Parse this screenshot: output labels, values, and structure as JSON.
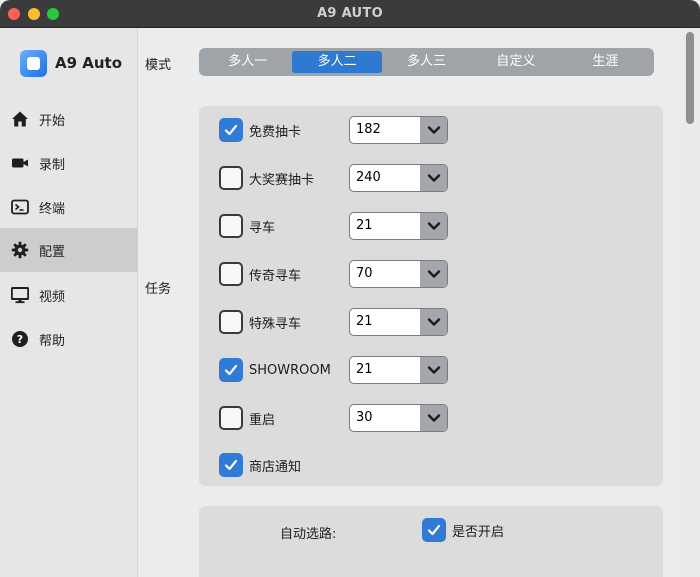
{
  "window": {
    "title": "A9 AUTO"
  },
  "brand": {
    "name": "A9 Auto",
    "icon": "app-logo-icon"
  },
  "sidebar": {
    "items": [
      {
        "label": "开始",
        "icon": "home-icon",
        "active": false
      },
      {
        "label": "录制",
        "icon": "camera-icon",
        "active": false
      },
      {
        "label": "终端",
        "icon": "terminal-icon",
        "active": false
      },
      {
        "label": "配置",
        "icon": "gear-icon",
        "active": true
      },
      {
        "label": "视频",
        "icon": "monitor-icon",
        "active": false
      },
      {
        "label": "帮助",
        "icon": "help-icon",
        "active": false
      }
    ]
  },
  "main": {
    "mode_label": "模式",
    "task_label": "任务",
    "mode_tabs": [
      {
        "label": "多人一",
        "selected": false
      },
      {
        "label": "多人二",
        "selected": true
      },
      {
        "label": "多人三",
        "selected": false
      },
      {
        "label": "自定义",
        "selected": false
      },
      {
        "label": "生涯",
        "selected": false
      }
    ],
    "tasks": [
      {
        "name": "免费抽卡",
        "checked": true,
        "value": "182"
      },
      {
        "name": "大奖赛抽卡",
        "checked": false,
        "value": "240"
      },
      {
        "name": "寻车",
        "checked": false,
        "value": "21"
      },
      {
        "name": "传奇寻车",
        "checked": false,
        "value": "70"
      },
      {
        "name": "特殊寻车",
        "checked": false,
        "value": "21"
      },
      {
        "name": "SHOWROOM",
        "checked": true,
        "value": "21"
      },
      {
        "name": "重启",
        "checked": false,
        "value": "30"
      },
      {
        "name": "商店通知",
        "checked": true,
        "value": null
      }
    ],
    "auto_route": {
      "label": "自动选路:",
      "checkbox_label": "是否开启",
      "checked": true
    }
  },
  "colors": {
    "accent": "#2e7ad1",
    "titlebar": "#3b3b3b",
    "sidebar_active": "#cdcdcd"
  }
}
